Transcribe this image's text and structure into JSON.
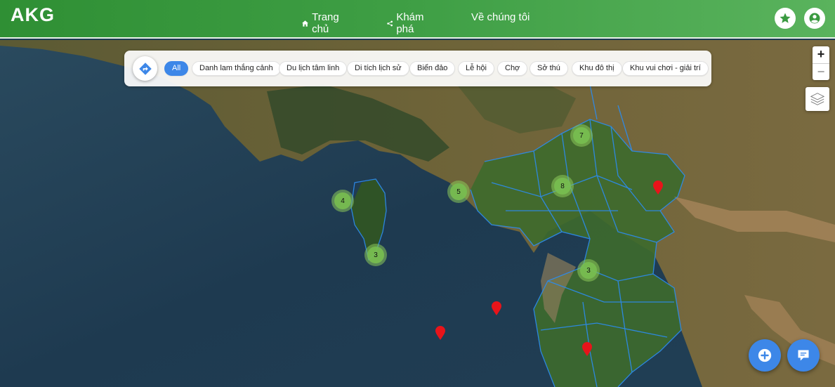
{
  "header": {
    "logo": "AKG",
    "nav": {
      "home": "Trang chủ",
      "explore": "Khám phá",
      "about": "Về chúng tôi"
    },
    "icons": {
      "favorite": "star-icon",
      "account": "user-circle-icon"
    }
  },
  "filter": {
    "route_icon": "directions-icon",
    "chips": [
      {
        "label": "All",
        "active": true
      },
      {
        "label": "Danh lam thắng cảnh"
      },
      {
        "label": "Du lịch tâm linh"
      },
      {
        "label": "Di tích lịch sử"
      },
      {
        "label": "Biển đảo"
      },
      {
        "label": "Lễ hội"
      },
      {
        "label": "Chợ"
      },
      {
        "label": "Sở thú"
      },
      {
        "label": "Khu đô thị"
      },
      {
        "label": "Khu vui chơi - giải trí"
      }
    ]
  },
  "map_controls": {
    "zoom_in": "+",
    "zoom_out": "−",
    "layers_icon": "layers-icon"
  },
  "clusters": [
    {
      "count": "7"
    },
    {
      "count": "8"
    },
    {
      "count": "5"
    },
    {
      "count": "4"
    },
    {
      "count": "3"
    },
    {
      "count": "3"
    }
  ],
  "colors": {
    "header_start": "#2f8f34",
    "header_end": "#5ab35d",
    "accent_blue": "#3d87e8",
    "marker_red": "#e8141a",
    "boundary_blue": "#2c8cf0"
  },
  "fabs": {
    "add_icon": "plus-circle-icon",
    "chat_icon": "chat-icon"
  }
}
